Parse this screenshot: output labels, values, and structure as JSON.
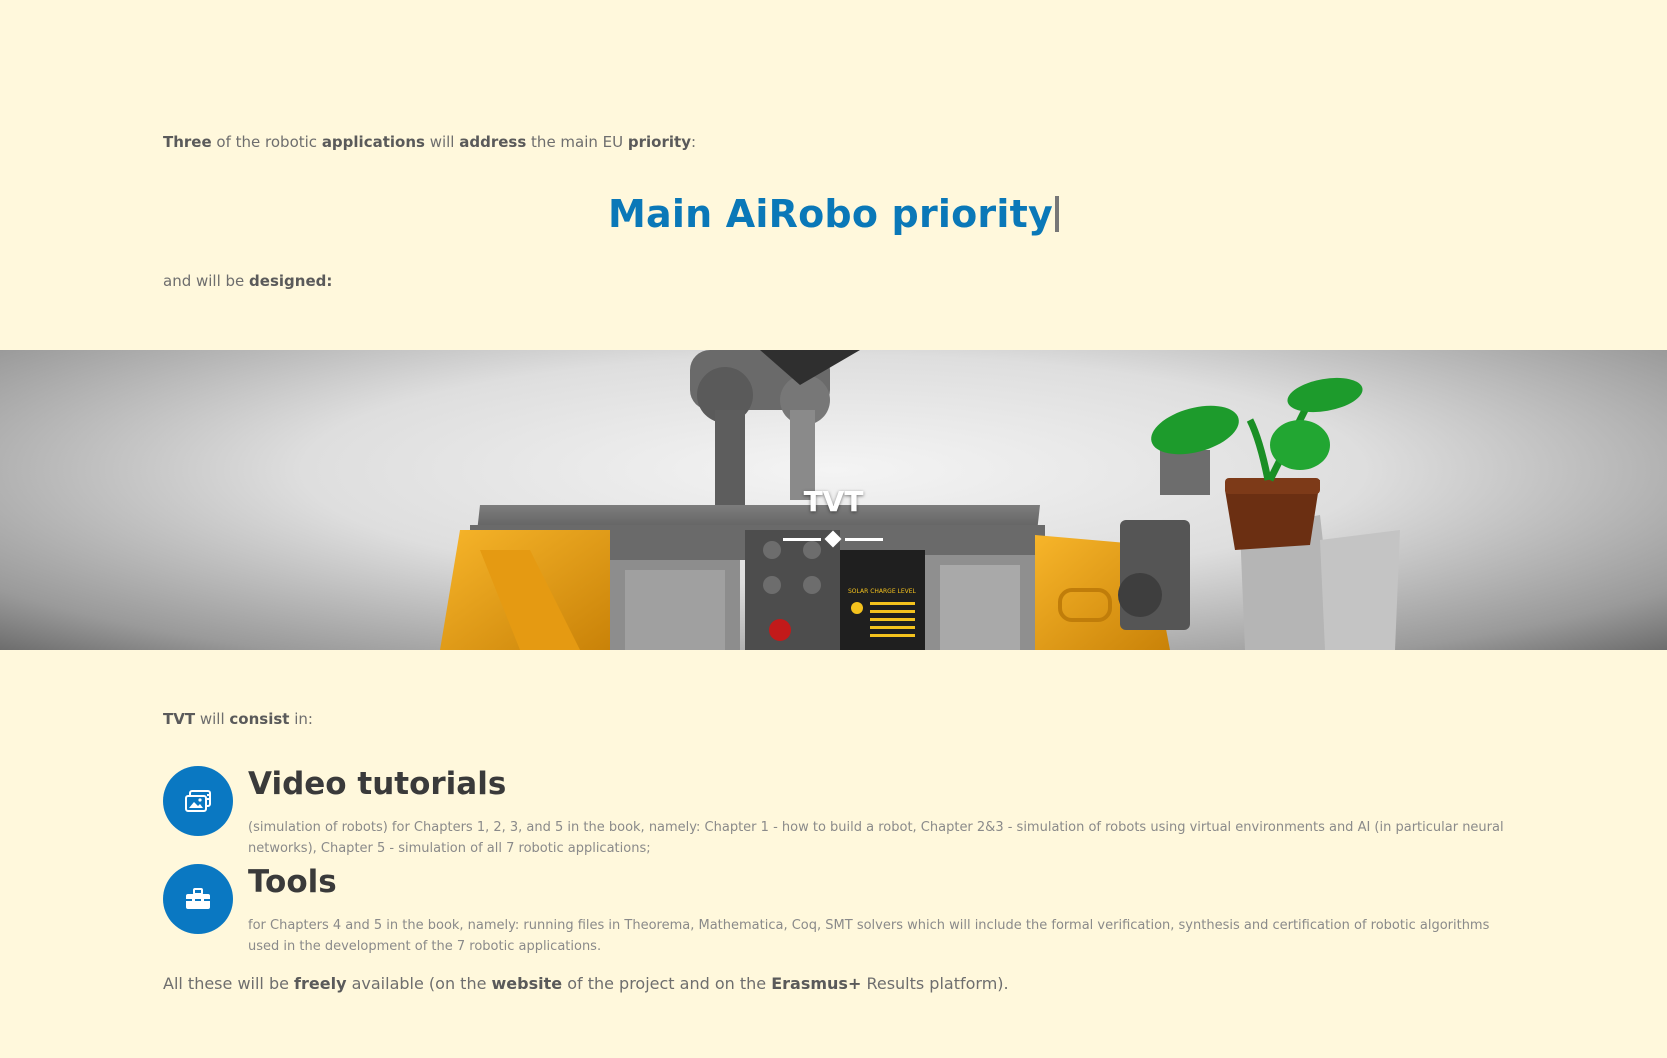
{
  "intro": {
    "w1": "Three",
    "t1": " of the robotic ",
    "w2": "applications",
    "t2": " will ",
    "w3": "address",
    "t3": " the main EU ",
    "w4": "priority",
    "t4": ":"
  },
  "main_priority": "Main AiRobo priority",
  "designed": {
    "t1": "and will be ",
    "w1": "designed:"
  },
  "hero": {
    "title": "TVT",
    "panel_label": "SOLAR CHARGE LEVEL"
  },
  "consist": {
    "w1": "TVT",
    "t1": " will ",
    "w2": "consist",
    "t2": " in:"
  },
  "features": [
    {
      "icon": "video-gallery-icon",
      "title": "Video tutorials",
      "description": "(simulation of robots) for Chapters 1, 2, 3, and 5 in the book, namely: Chapter 1 - how to build a robot, Chapter 2&3 - simulation of robots using virtual environments and AI (in particular neural networks), Chapter 5 - simulation of all 7 robotic applications;"
    },
    {
      "icon": "toolbox-icon",
      "title": "Tools",
      "description": "for Chapters 4 and 5 in the book, namely: running files in Theorema, Mathematica, Coq, SMT solvers which will include the formal verification, synthesis and certification of robotic algorithms used in the development of the 7 robotic applications."
    }
  ],
  "closing": {
    "t1": "All these will be ",
    "w1": "freely",
    "t2": " available (on the ",
    "w2": "website",
    "t3": " of the project and on the ",
    "w3": "Erasmus+",
    "t4": " Results platform)."
  },
  "colors": {
    "background": "#fff8dc",
    "accent_blue": "#0a78b8",
    "icon_blue": "#0a78c2",
    "heading_dark": "#3a3a3a",
    "robot_yellow": "#f2a71b",
    "plant_green": "#1d9b2c"
  }
}
